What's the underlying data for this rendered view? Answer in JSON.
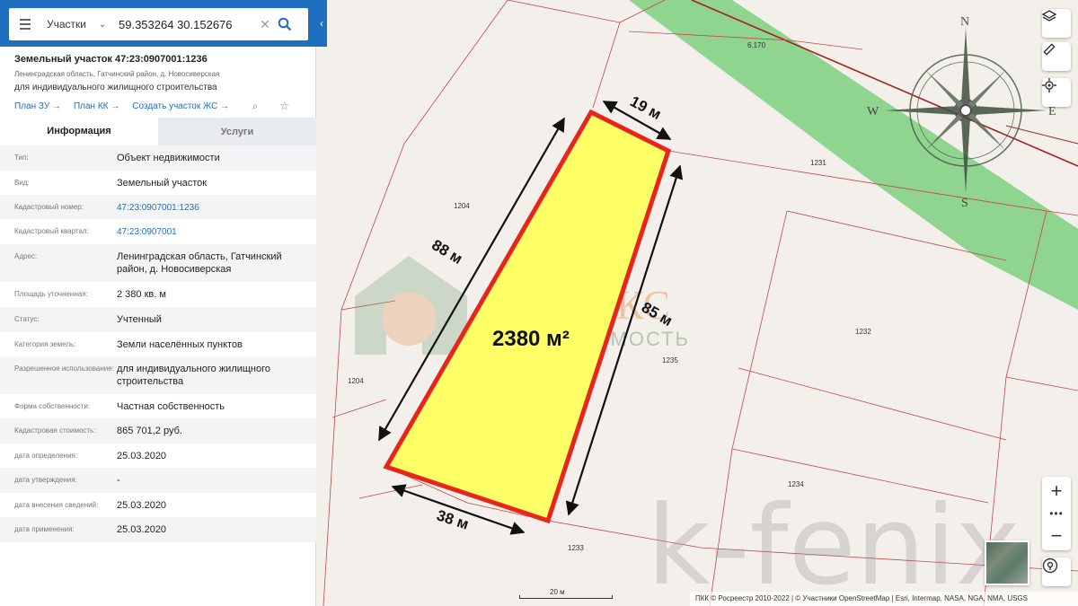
{
  "search": {
    "type_label": "Участки",
    "query": "59.353264 30.152676"
  },
  "object": {
    "title": "Земельный участок 47:23:0907001:1236",
    "address_short": "Ленинградская область, Гатчинский район, д. Новосиверская",
    "purpose": "для индивидуального жилищного строительства",
    "links": [
      "План ЗУ",
      "План КК",
      "Создать участок ЖС"
    ]
  },
  "tabs": [
    {
      "label": "Информация",
      "active": true
    },
    {
      "label": "Услуги",
      "active": false
    }
  ],
  "attributes": [
    {
      "key": "Тип:",
      "value": "Объект недвижимости"
    },
    {
      "key": "Вид:",
      "value": "Земельный участок"
    },
    {
      "key": "Кадастровый номер:",
      "value": "47:23:0907001:1236",
      "link": true
    },
    {
      "key": "Кадастровый квартал:",
      "value": "47:23:0907001",
      "link": true
    },
    {
      "key": "Адрес:",
      "value": "Ленинградская область, Гатчинский район, д. Новосиверская"
    },
    {
      "key": "Площадь уточненная:",
      "value": "2 380 кв. м"
    },
    {
      "key": "Статус:",
      "value": "Учтенный"
    },
    {
      "key": "Категория земель:",
      "value": "Земли населённых пунктов"
    },
    {
      "key": "Разрешенное использование:",
      "value": "для индивидуального жилищного строительства"
    },
    {
      "key": "Форма собственности:",
      "value": "Частная собственность"
    },
    {
      "key": "Кадастровая стоимость:",
      "value": "865 701,2 руб."
    },
    {
      "key": "дата определения:",
      "value": "25.03.2020"
    },
    {
      "key": "дата утверждения:",
      "value": "-"
    },
    {
      "key": "дата внесения сведений:",
      "value": "25.03.2020"
    },
    {
      "key": "дата применения:",
      "value": "25.03.2020"
    }
  ],
  "map": {
    "plot": {
      "area_label": "2380 м²",
      "side_top": "19 м",
      "side_left": "88 м",
      "side_right": "85 м",
      "side_bottom": "38 м",
      "fill_color": "#ffff66",
      "border_color": "#e8241c"
    },
    "parcel_labels": {
      "p1204a": "1204",
      "p1204b": "1204",
      "p1231": "1231",
      "p1232": "1232",
      "p1235": "1235",
      "p1234": "1234",
      "p1233": "1233",
      "p6170": "6.170"
    },
    "compass": {
      "n": "N",
      "s": "S",
      "w": "W",
      "e": "E"
    },
    "watermark_main": "k-fenix",
    "logo_text_1": "ФЕНИКС",
    "logo_text_2": "ДВИЖИМОСТЬ",
    "scale_label": "20 м",
    "attribution": "ПКК © Росреестр 2010-2022 | © Участники OpenStreetMap | Esri, Intermap, NASA, NGA, NMA, USGS"
  }
}
